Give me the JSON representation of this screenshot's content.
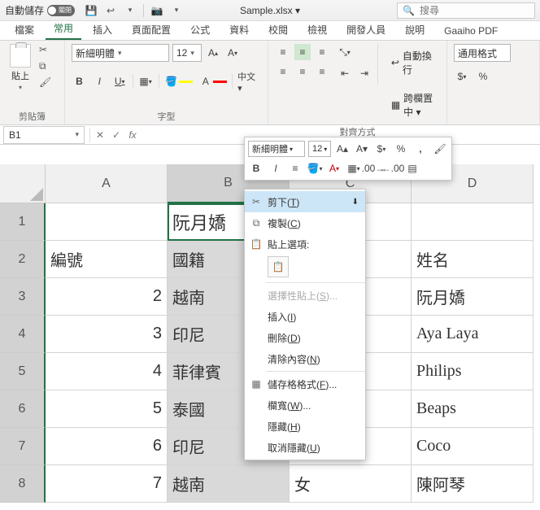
{
  "titlebar": {
    "autosave_label": "自動儲存",
    "autosave_state": "關閉",
    "filename": "Sample.xlsx ▾",
    "search_placeholder": "搜尋"
  },
  "tabs": {
    "items": [
      "檔案",
      "常用",
      "插入",
      "頁面配置",
      "公式",
      "資料",
      "校閱",
      "檢視",
      "開發人員",
      "說明",
      "Gaaiho PDF"
    ],
    "active": "常用"
  },
  "ribbon": {
    "clipboard": {
      "paste": "貼上",
      "label": "剪貼簿"
    },
    "font": {
      "name": "新細明體",
      "size": "12",
      "label": "字型",
      "phonetic": "中文 ▾"
    },
    "align": {
      "label": "對齊方式",
      "wrap": "自動換行",
      "merge": "跨欄置中 ▾"
    },
    "number": {
      "format": "通用格式",
      "label": ""
    }
  },
  "formula_bar": {
    "namebox": "B1"
  },
  "mini_toolbar": {
    "font": "新細明體",
    "size": "12"
  },
  "context_menu": {
    "items": [
      {
        "icon": "✂",
        "label": "剪下",
        "accel": "T",
        "marker": "⬇",
        "hover": true
      },
      {
        "icon": "⧉",
        "label": "複製",
        "accel": "C"
      },
      {
        "icon": "📋",
        "label": "貼上選項:",
        "is_header": true
      },
      {
        "paste_option": true
      },
      {
        "label": "選擇性貼上",
        "accel": "S",
        "suffix": "...",
        "disabled": true
      },
      {
        "label": "插入",
        "accel": "I"
      },
      {
        "label": "刪除",
        "accel": "D"
      },
      {
        "label": "清除內容",
        "accel": "N"
      },
      {
        "icon": "▦",
        "label": "儲存格格式",
        "accel": "F",
        "suffix": "..."
      },
      {
        "label": "欄寬",
        "accel": "W",
        "suffix": "..."
      },
      {
        "label": "隱藏",
        "accel": "H"
      },
      {
        "label": "取消隱藏",
        "accel": "U"
      }
    ]
  },
  "grid": {
    "columns": [
      "A",
      "B",
      "C",
      "D"
    ],
    "selected_col": "B",
    "rows": [
      {
        "num": "1",
        "cells": [
          "",
          "阮月嬌",
          "",
          ""
        ]
      },
      {
        "num": "2",
        "cells": [
          "編號",
          "國籍",
          "",
          "姓名"
        ]
      },
      {
        "num": "3",
        "cells": [
          "2",
          "越南",
          "",
          "阮月嬌"
        ],
        "right0": true
      },
      {
        "num": "4",
        "cells": [
          "3",
          "印尼",
          "",
          "Aya Laya"
        ],
        "right0": true
      },
      {
        "num": "5",
        "cells": [
          "4",
          "菲律賓",
          "",
          "Philips"
        ],
        "right0": true
      },
      {
        "num": "6",
        "cells": [
          "5",
          "泰國",
          "",
          "Beaps"
        ],
        "right0": true
      },
      {
        "num": "7",
        "cells": [
          "6",
          "印尼",
          "",
          "Coco"
        ],
        "right0": true
      },
      {
        "num": "8",
        "cells": [
          "7",
          "越南",
          "女",
          "陳阿琴"
        ],
        "right0": true
      }
    ]
  }
}
